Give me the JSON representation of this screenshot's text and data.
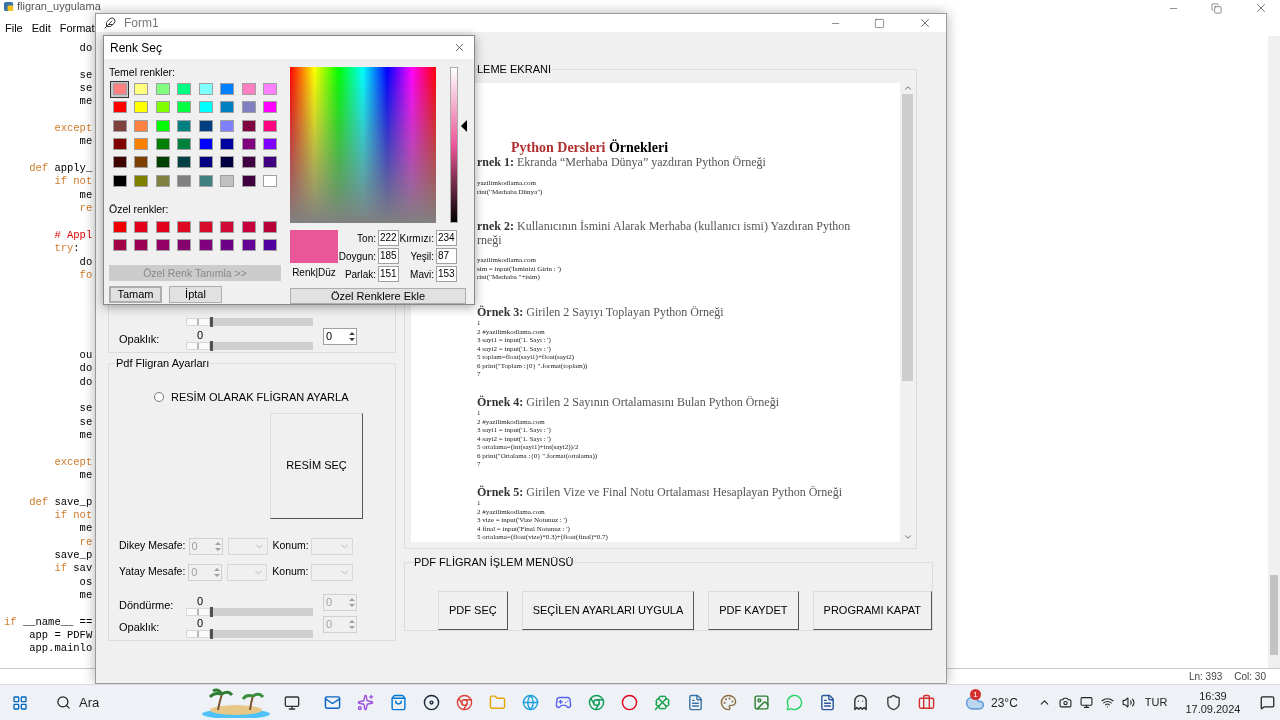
{
  "editor": {
    "title": "fligran_uygulama",
    "menu": [
      "File",
      "Edit",
      "Format"
    ],
    "code": [
      {
        "kind": "code",
        "parts": [
          {
            "t": "            do",
            "kind": "plain"
          }
        ]
      },
      {
        "kind": "blank"
      },
      {
        "kind": "code",
        "parts": [
          {
            "t": "            se",
            "kind": "plain"
          }
        ]
      },
      {
        "kind": "code",
        "parts": [
          {
            "t": "            se",
            "kind": "plain"
          }
        ]
      },
      {
        "kind": "code",
        "parts": [
          {
            "t": "            me",
            "kind": "plain"
          }
        ]
      },
      {
        "kind": "blank"
      },
      {
        "kind": "code",
        "parts": [
          {
            "t": "        except",
            "kind": "keyword"
          }
        ]
      },
      {
        "kind": "code",
        "parts": [
          {
            "t": "            me",
            "kind": "plain"
          }
        ]
      },
      {
        "kind": "blank"
      },
      {
        "kind": "code",
        "parts": [
          {
            "t": "    def",
            "kind": "keyword"
          },
          {
            "t": " apply_",
            "kind": "plain"
          }
        ]
      },
      {
        "kind": "code",
        "parts": [
          {
            "t": "        if not",
            "kind": "keyword"
          }
        ]
      },
      {
        "kind": "code",
        "parts": [
          {
            "t": "            me",
            "kind": "plain"
          }
        ]
      },
      {
        "kind": "code",
        "parts": [
          {
            "t": "            re",
            "kind": "keyword"
          }
        ]
      },
      {
        "kind": "blank"
      },
      {
        "kind": "code",
        "parts": [
          {
            "t": "        # Appl",
            "kind": "comment"
          }
        ]
      },
      {
        "kind": "code",
        "parts": [
          {
            "t": "        try",
            "kind": "keyword"
          },
          {
            "t": ":",
            "kind": "plain"
          }
        ]
      },
      {
        "kind": "code",
        "parts": [
          {
            "t": "            do",
            "kind": "plain"
          }
        ]
      },
      {
        "kind": "code",
        "parts": [
          {
            "t": "            fo",
            "kind": "keyword"
          }
        ]
      },
      {
        "kind": "blank"
      },
      {
        "kind": "blank"
      },
      {
        "kind": "blank"
      },
      {
        "kind": "blank"
      },
      {
        "kind": "blank"
      },
      {
        "kind": "code",
        "parts": [
          {
            "t": "            ou",
            "kind": "plain"
          }
        ]
      },
      {
        "kind": "code",
        "parts": [
          {
            "t": "            do",
            "kind": "plain"
          }
        ]
      },
      {
        "kind": "code",
        "parts": [
          {
            "t": "            do",
            "kind": "plain"
          }
        ]
      },
      {
        "kind": "blank"
      },
      {
        "kind": "code",
        "parts": [
          {
            "t": "            se",
            "kind": "plain"
          }
        ]
      },
      {
        "kind": "code",
        "parts": [
          {
            "t": "            se",
            "kind": "plain"
          }
        ]
      },
      {
        "kind": "code",
        "parts": [
          {
            "t": "            me",
            "kind": "plain"
          }
        ]
      },
      {
        "kind": "blank"
      },
      {
        "kind": "code",
        "parts": [
          {
            "t": "        except",
            "kind": "keyword"
          }
        ]
      },
      {
        "kind": "code",
        "parts": [
          {
            "t": "            me",
            "kind": "plain"
          }
        ]
      },
      {
        "kind": "blank"
      },
      {
        "kind": "code",
        "parts": [
          {
            "t": "    def",
            "kind": "keyword"
          },
          {
            "t": " save_p",
            "kind": "plain"
          }
        ]
      },
      {
        "kind": "code",
        "parts": [
          {
            "t": "        if not",
            "kind": "keyword"
          }
        ]
      },
      {
        "kind": "code",
        "parts": [
          {
            "t": "            me",
            "kind": "plain"
          }
        ]
      },
      {
        "kind": "code",
        "parts": [
          {
            "t": "            re",
            "kind": "keyword"
          }
        ]
      },
      {
        "kind": "code",
        "parts": [
          {
            "t": "        save_p",
            "kind": "plain"
          }
        ]
      },
      {
        "kind": "code",
        "parts": [
          {
            "t": "        if",
            "kind": "keyword"
          },
          {
            "t": " sav",
            "kind": "plain"
          }
        ]
      },
      {
        "kind": "code",
        "parts": [
          {
            "t": "            os",
            "kind": "plain"
          }
        ]
      },
      {
        "kind": "code",
        "parts": [
          {
            "t": "            me",
            "kind": "plain"
          }
        ]
      },
      {
        "kind": "blank"
      },
      {
        "kind": "code",
        "parts": [
          {
            "t": "if",
            "kind": "keyword"
          },
          {
            "t": " __name__ ==",
            "kind": "plain"
          }
        ]
      },
      {
        "kind": "code",
        "parts": [
          {
            "t": "    app = PDFW",
            "kind": "plain"
          }
        ]
      },
      {
        "kind": "code",
        "parts": [
          {
            "t": "    app.mainlo",
            "kind": "plain"
          }
        ]
      }
    ],
    "status": {
      "line": "Ln: 393",
      "col": "Col: 30"
    }
  },
  "form": {
    "title": "Form1",
    "top_group": {
      "slider": {
        "level": 0
      },
      "row": {
        "label": "Opaklık:",
        "value": "0",
        "spin": "0",
        "level": 0,
        "disabled": false
      }
    },
    "pdf_settings": {
      "title": "Pdf Fligran Ayarları",
      "radio": {
        "label": "RESİM OLARAK FLİGRAN AYARLA",
        "checked": false
      },
      "image_button": "RESİM SEÇ",
      "offsets": [
        {
          "label": "Dikey Mesafe:",
          "spin": "0",
          "position_label": "Konum:",
          "disabled": true
        },
        {
          "label": "Yatay Mesafe:",
          "spin": "0",
          "position_label": "Konum:",
          "disabled": true
        }
      ],
      "sliders": [
        {
          "label": "Döndürme:",
          "value": "0",
          "spin": "0",
          "level": 0,
          "disabled": true
        },
        {
          "label": "Opaklık:",
          "value": "0",
          "spin": "0",
          "level": 0,
          "disabled": true
        }
      ]
    },
    "preview": {
      "title": "LEME EKRANI",
      "doc_title_red": "Python Dersleri",
      "doc_title": "Örnekleri",
      "examples": [
        {
          "label": "rnek 1:",
          "heading": [
            "Ekranda “Merhaba Dünya” yazdıran Python Örneği"
          ],
          "lines": [
            "yazilimkodlama.com",
            "rint(\"Merhaba Dünya\")"
          ]
        },
        {
          "label": "rnek 2:",
          "heading": [
            "Kullanıcının İsmini Alarak Merhaba (kullanıcı ismi) Yazdıran Python",
            "rneği"
          ],
          "lines": [
            "yazilimkodlama.com",
            "sim = input('İsminizi Girin : ')",
            "rint(\"Merhaba \"+isim)"
          ]
        },
        {
          "label": "Örnek 3:",
          "heading": [
            "Girilen 2 Sayıyı Toplayan Python Örneği"
          ],
          "lines": [
            "1",
            "2 #yazilimkodlama.com",
            "3 sayi1 = input('1. Sayı : ')",
            "4 sayi2 = input('1. Sayı : ')",
            "5 toplam=float(sayi1)+float(sayi2)",
            "6 print(\"Toplam :{0} \".format(toplam))",
            "7"
          ]
        },
        {
          "label": "Örnek 4:",
          "heading": [
            "Girilen 2 Sayının Ortalamasını Bulan Python Örneği"
          ],
          "lines": [
            "1",
            "2 #yazilimkodlama.com",
            "3 sayi1 = input('1. Sayı : ')",
            "4 sayi2 = input('1. Sayı : ')",
            "5 ortalama=(int(sayi1)+int(sayi2))/2",
            "6 print(\"Ortalama :{0} \".format(ortalama))",
            "7"
          ]
        },
        {
          "label": "Örnek 5:",
          "heading": [
            "Girilen Vize ve Final Notu Ortalaması Hesaplayan Python Örneği"
          ],
          "lines": [
            "1",
            "2 #yazilimkodlama.com",
            "3 vize = input('Vize Notunuz : ')",
            "4 final = input('Final Notunuz : ')",
            "5 ortalama=(float(vize)*0.3)+(float(final)*0.7)"
          ]
        }
      ]
    },
    "menu": {
      "title": "PDF FLİGRAN İŞLEM MENÜSÜ",
      "buttons": [
        "PDF SEÇ",
        "SEÇİLEN AYARLARI UYGULA",
        "PDF KAYDET",
        "PROGRAMI KAPAT"
      ]
    }
  },
  "dialog": {
    "title": "Renk Seç",
    "basic_label": "Temel renkler:",
    "basic": [
      {
        "color": "#ff8080",
        "selected": true
      },
      {
        "color": "#ffff80",
        "selected": false
      },
      {
        "color": "#80ff80",
        "selected": false
      },
      {
        "color": "#00ff80",
        "selected": false
      },
      {
        "color": "#80ffff",
        "selected": false
      },
      {
        "color": "#0080ff",
        "selected": false
      },
      {
        "color": "#ff80c0",
        "selected": false
      },
      {
        "color": "#ff80ff",
        "selected": false
      },
      {
        "color": "#ff0000",
        "selected": false
      },
      {
        "color": "#ffff00",
        "selected": false
      },
      {
        "color": "#80ff00",
        "selected": false
      },
      {
        "color": "#00ff40",
        "selected": false
      },
      {
        "color": "#00ffff",
        "selected": false
      },
      {
        "color": "#0080c0",
        "selected": false
      },
      {
        "color": "#8080c0",
        "selected": false
      },
      {
        "color": "#ff00ff",
        "selected": false
      },
      {
        "color": "#804040",
        "selected": false
      },
      {
        "color": "#ff8040",
        "selected": false
      },
      {
        "color": "#00ff00",
        "selected": false
      },
      {
        "color": "#008080",
        "selected": false
      },
      {
        "color": "#004080",
        "selected": false
      },
      {
        "color": "#8080ff",
        "selected": false
      },
      {
        "color": "#800040",
        "selected": false
      },
      {
        "color": "#ff0080",
        "selected": false
      },
      {
        "color": "#800000",
        "selected": false
      },
      {
        "color": "#ff8000",
        "selected": false
      },
      {
        "color": "#008000",
        "selected": false
      },
      {
        "color": "#008040",
        "selected": false
      },
      {
        "color": "#0000ff",
        "selected": false
      },
      {
        "color": "#0000a0",
        "selected": false
      },
      {
        "color": "#800080",
        "selected": false
      },
      {
        "color": "#8000ff",
        "selected": false
      },
      {
        "color": "#400000",
        "selected": false
      },
      {
        "color": "#804000",
        "selected": false
      },
      {
        "color": "#004000",
        "selected": false
      },
      {
        "color": "#004040",
        "selected": false
      },
      {
        "color": "#000080",
        "selected": false
      },
      {
        "color": "#000040",
        "selected": false
      },
      {
        "color": "#400040",
        "selected": false
      },
      {
        "color": "#400080",
        "selected": false
      },
      {
        "color": "#000000",
        "selected": false
      },
      {
        "color": "#808000",
        "selected": false
      },
      {
        "color": "#808040",
        "selected": false
      },
      {
        "color": "#808080",
        "selected": false
      },
      {
        "color": "#408080",
        "selected": false
      },
      {
        "color": "#c0c0c0",
        "selected": false
      },
      {
        "color": "#400040",
        "selected": false
      },
      {
        "color": "#ffffff",
        "selected": false
      }
    ],
    "custom_label": "Özel renkler:",
    "custom": [
      {
        "color": "#ee0000"
      },
      {
        "color": "#e4001a"
      },
      {
        "color": "#e0001c"
      },
      {
        "color": "#dc0a22"
      },
      {
        "color": "#d70a2c"
      },
      {
        "color": "#cf0a34"
      },
      {
        "color": "#c8003c"
      },
      {
        "color": "#b80038"
      },
      {
        "color": "#a30047"
      },
      {
        "color": "#9e0055"
      },
      {
        "color": "#930068"
      },
      {
        "color": "#870070"
      },
      {
        "color": "#80007d"
      },
      {
        "color": "#6e0088"
      },
      {
        "color": "#650096"
      },
      {
        "color": "#5200a0"
      }
    ],
    "define_button": {
      "label": "Özel Renk Tanımla >>",
      "disabled": true
    },
    "ok": "Tamam",
    "cancel": "İptal",
    "preview": {
      "color": "#ea5799",
      "label": "Renk|Düz"
    },
    "luminance": {
      "level": 0.63
    },
    "fields": [
      {
        "label": "Ton:",
        "value": "222"
      },
      {
        "label": "Kırmızı:",
        "value": "234"
      },
      {
        "label": "Doygun:",
        "value": "185"
      },
      {
        "label": "Yeşil:",
        "value": "87"
      },
      {
        "label": "Parlak:",
        "value": "151"
      },
      {
        "label": "Mavi:",
        "value": "153"
      }
    ],
    "add_button": "Özel Renklere Ekle"
  },
  "taskbar": {
    "search": {
      "placeholder": "Ara"
    },
    "weather": {
      "badge": "1",
      "temp": "23°C"
    },
    "language": "TUR",
    "time": "16:39",
    "date": "17.09.2024"
  }
}
